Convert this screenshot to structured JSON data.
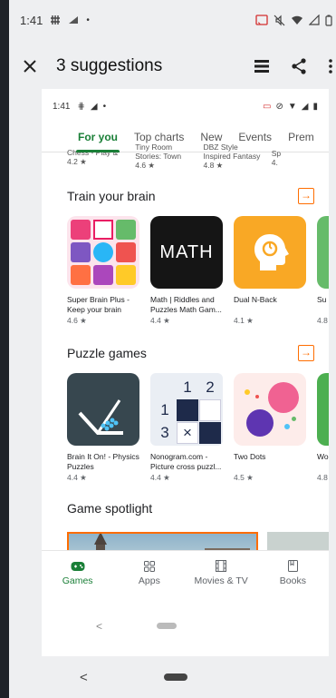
{
  "status": {
    "time": "1:41"
  },
  "appbar": {
    "title": "3 suggestions"
  },
  "inner_status": {
    "time": "1:41"
  },
  "tabs": [
    {
      "label": "For you",
      "active": true
    },
    {
      "label": "Top charts"
    },
    {
      "label": "New"
    },
    {
      "label": "Events"
    },
    {
      "label": "Prem"
    }
  ],
  "prev_row": [
    {
      "name": "Chess - Play & Learn",
      "rating": "4.2 ★"
    },
    {
      "name": "Tiny Room Stories: Town Mystery",
      "rating": "4.6 ★"
    },
    {
      "name": "DBZ Style Inspired Fantasy RPG (Choi...",
      "rating": "4.8 ★"
    },
    {
      "name": "Sp",
      "rating": "4."
    }
  ],
  "sections": [
    {
      "title": "Train your brain",
      "arrow": "→",
      "apps": [
        {
          "name": "Super Brain Plus - Keep your brain acti...",
          "rating": "4.6 ★"
        },
        {
          "name": "Math | Riddles and Puzzles Math Gam...",
          "rating": "4.4 ★",
          "icon_text": "MATH"
        },
        {
          "name": "Dual N-Back",
          "rating": "4.1 ★"
        },
        {
          "name": "Su",
          "rating": "4.8"
        }
      ]
    },
    {
      "title": "Puzzle games",
      "arrow": "→",
      "apps": [
        {
          "name": "Brain It On! - Physics Puzzles",
          "rating": "4.4 ★"
        },
        {
          "name": "Nonogram.com - Picture cross puzzl...",
          "rating": "4.4 ★",
          "grid": [
            "1",
            "2",
            "1",
            "3",
            "×"
          ]
        },
        {
          "name": "Two Dots",
          "rating": "4.5 ★"
        },
        {
          "name": "Wo",
          "rating": "4.8"
        }
      ]
    }
  ],
  "spotlight": {
    "title": "Game spotlight"
  },
  "bottomnav": [
    {
      "label": "Games",
      "active": true
    },
    {
      "label": "Apps"
    },
    {
      "label": "Movies & TV"
    },
    {
      "label": "Books"
    }
  ],
  "nav": {
    "back": "<"
  },
  "colors": {
    "accent": "#1a7f37",
    "arrow": "#ff6d00",
    "dual_nback": "#f9a825"
  }
}
